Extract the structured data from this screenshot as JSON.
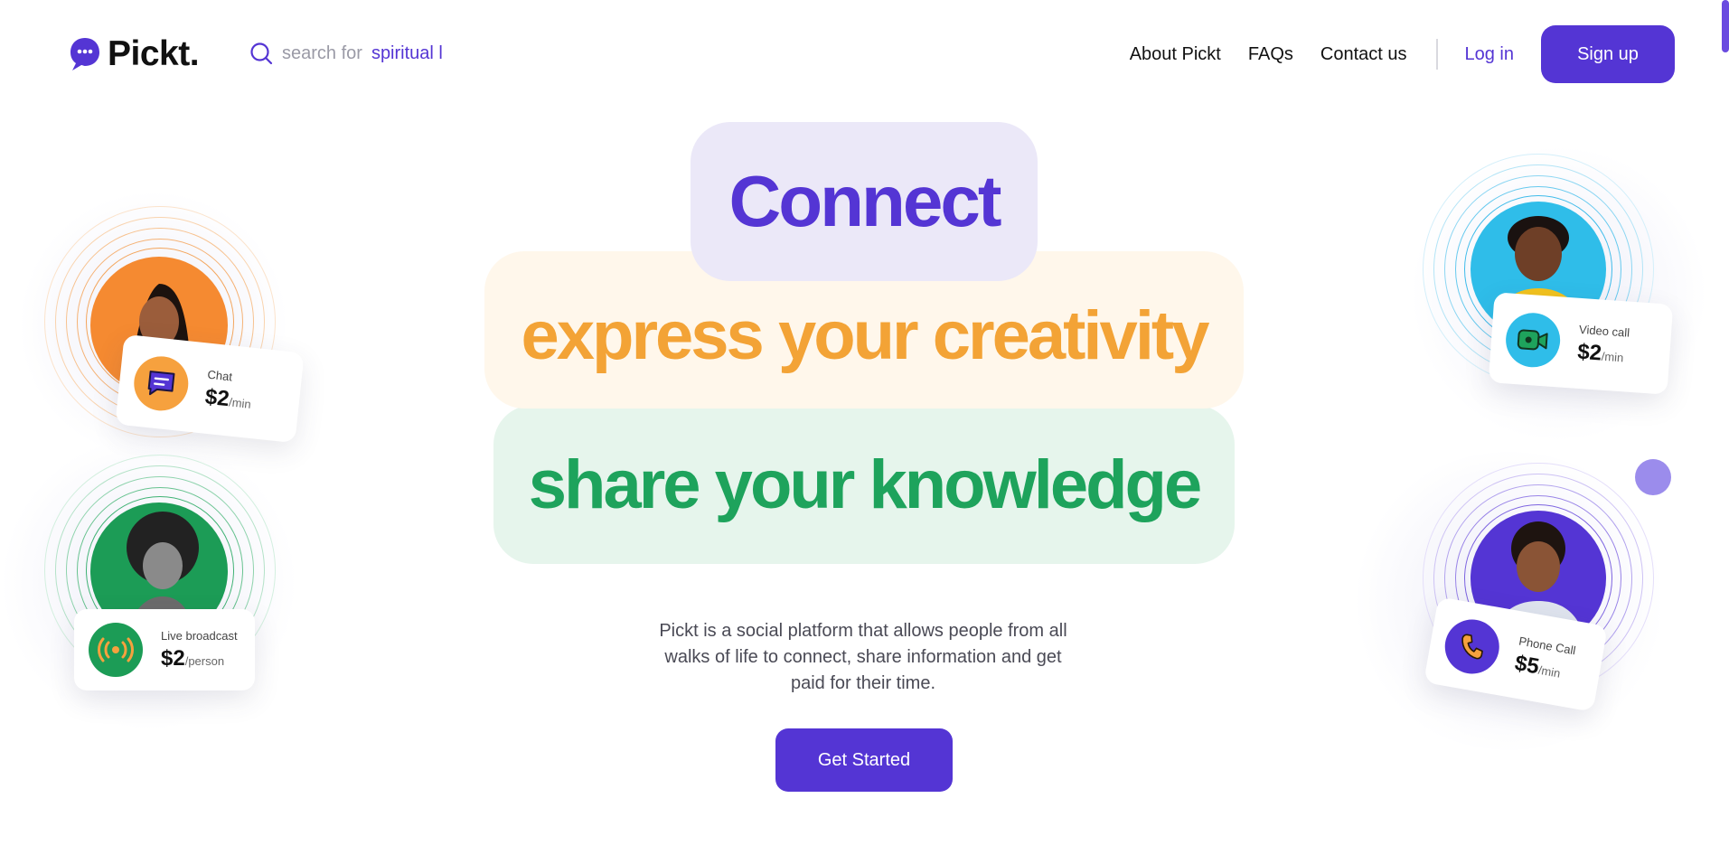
{
  "nav": {
    "logo_text": "Pickt.",
    "search_prefix": "search for",
    "search_typed": "spiritual l",
    "links": [
      "About Pickt",
      "FAQs",
      "Contact us"
    ],
    "login_label": "Log in",
    "signup_label": "Sign up"
  },
  "hero": {
    "line1": "Connect",
    "line2": "express your creativity",
    "line3": "share your knowledge",
    "description": "Pickt is a social platform that allows people from all walks of life to connect, share information and get paid for their time.",
    "cta_label": "Get Started"
  },
  "cards": {
    "chat": {
      "label": "Chat",
      "price": "$2",
      "unit": "/min",
      "icon": "chat-bubble-icon"
    },
    "broadcast": {
      "label": "Live broadcast",
      "price": "$2",
      "unit": "/person",
      "icon": "broadcast-icon"
    },
    "video": {
      "label": "Video call",
      "price": "$2",
      "unit": "/min",
      "icon": "video-camera-icon"
    },
    "phone": {
      "label": "Phone Call",
      "price": "$5",
      "unit": "/min",
      "icon": "phone-icon"
    }
  },
  "colors": {
    "brand": "#5435d4",
    "orange": "#f3a336",
    "green": "#1ea35c",
    "sky": "#2fbde9"
  }
}
